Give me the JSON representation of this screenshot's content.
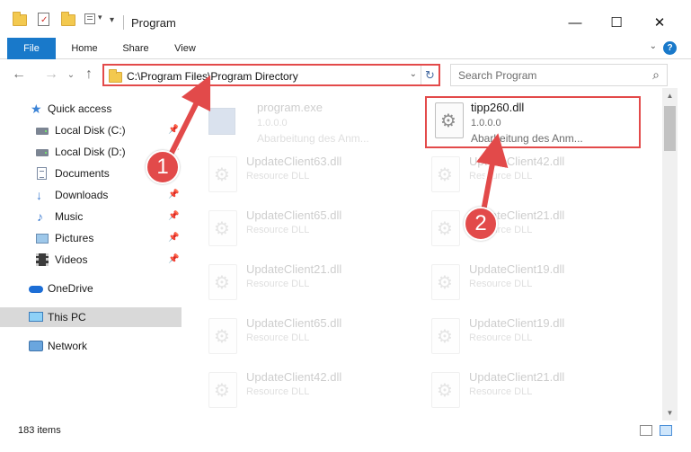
{
  "window": {
    "title": "Program",
    "minimize_glyph": "—",
    "maximize_glyph": "☐",
    "close_glyph": "✕"
  },
  "ribbon": {
    "tabs": [
      "File",
      "Home",
      "Share",
      "View"
    ],
    "help_glyph": "?",
    "collapse_glyph": "⌄"
  },
  "navigation": {
    "back_glyph": "←",
    "forward_glyph": "→",
    "recent_glyph": "⌄",
    "up_glyph": "↑"
  },
  "address": {
    "path": "C:\\Program Files\\Program Directory",
    "dropdown_glyph": "⌄",
    "refresh_glyph": "↻"
  },
  "search": {
    "placeholder": "Search Program",
    "icon_glyph": "⌕"
  },
  "sidebar": {
    "items": [
      {
        "label": "Quick access",
        "icon": "star-icon"
      },
      {
        "label": "Local Disk (C:)",
        "icon": "drive-icon",
        "pinned": true
      },
      {
        "label": "Local Disk (D:)",
        "icon": "drive-icon",
        "pinned": true
      },
      {
        "label": "Documents",
        "icon": "document-icon",
        "pinned": true
      },
      {
        "label": "Downloads",
        "icon": "download-icon",
        "pinned": true
      },
      {
        "label": "Music",
        "icon": "music-icon",
        "pinned": true
      },
      {
        "label": "Pictures",
        "icon": "picture-icon",
        "pinned": true
      },
      {
        "label": "Videos",
        "icon": "video-icon",
        "pinned": true
      },
      {
        "label": "OneDrive",
        "icon": "cloud-icon"
      },
      {
        "label": "This PC",
        "icon": "computer-icon"
      },
      {
        "label": "Network",
        "icon": "network-icon"
      }
    ],
    "pin_glyph": "📌"
  },
  "files": [
    {
      "name": "program.exe",
      "version": "1.0.0.0",
      "description": "Abarbeitung des Anm...",
      "type": "exe",
      "faded": true
    },
    {
      "name": "tipp260.dll",
      "version": "1.0.0.0",
      "description": "Abarbeitung des Anm...",
      "type": "dll",
      "faded": false
    },
    {
      "name": "UpdateClient63.dll",
      "version": "",
      "description": "Resource DLL",
      "type": "dll",
      "faded": true
    },
    {
      "name": "UpdateClient42.dll",
      "version": "",
      "description": "Resource DLL",
      "type": "dll",
      "faded": true
    },
    {
      "name": "UpdateClient65.dll",
      "version": "",
      "description": "Resource DLL",
      "type": "dll",
      "faded": true
    },
    {
      "name": "UpdateClient21.dll",
      "version": "",
      "description": "Resource DLL",
      "type": "dll",
      "faded": true
    },
    {
      "name": "UpdateClient21.dll",
      "version": "",
      "description": "Resource DLL",
      "type": "dll",
      "faded": true
    },
    {
      "name": "UpdateClient19.dll",
      "version": "",
      "description": "Resource DLL",
      "type": "dll",
      "faded": true
    },
    {
      "name": "UpdateClient65.dll",
      "version": "",
      "description": "Resource DLL",
      "type": "dll",
      "faded": true
    },
    {
      "name": "UpdateClient19.dll",
      "version": "",
      "description": "Resource DLL",
      "type": "dll",
      "faded": true
    },
    {
      "name": "UpdateClient42.dll",
      "version": "",
      "description": "Resource DLL",
      "type": "dll",
      "faded": true
    },
    {
      "name": "UpdateClient21.dll",
      "version": "",
      "description": "Resource DLL",
      "type": "dll",
      "faded": true
    }
  ],
  "scrollbar": {
    "up_glyph": "▲",
    "down_glyph": "▼"
  },
  "status": {
    "item_count": "183 items"
  },
  "annotations": {
    "step1": "1",
    "step2": "2",
    "color": "#e24a4a"
  }
}
